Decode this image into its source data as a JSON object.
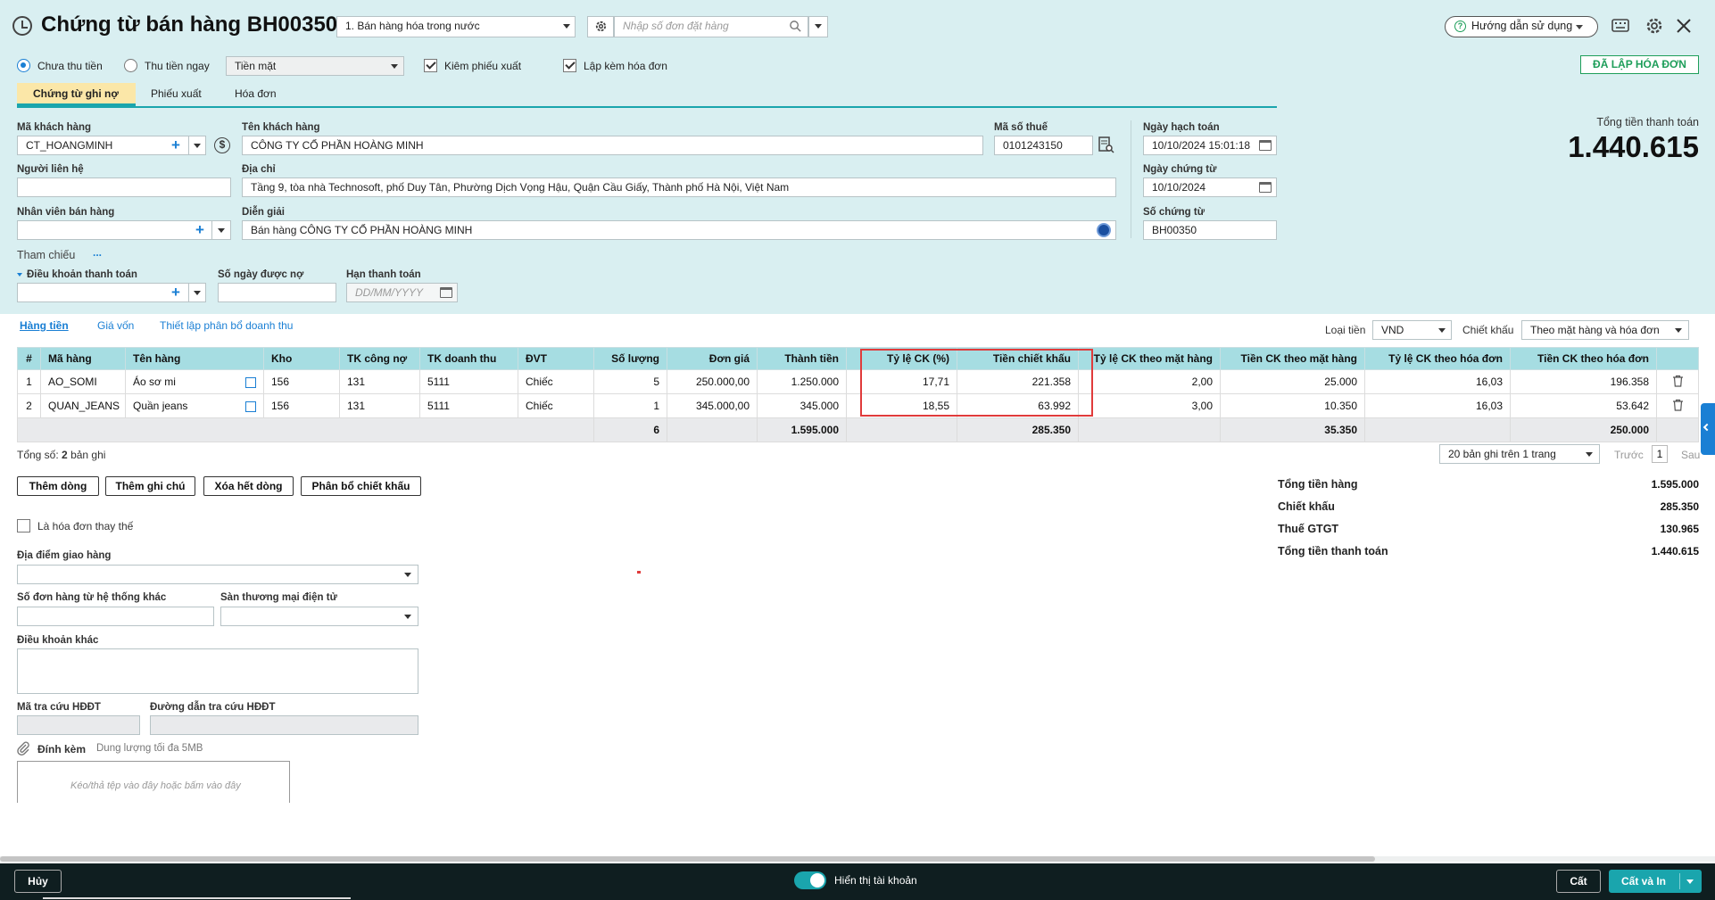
{
  "header": {
    "title": "Chứng từ bán hàng BH00350",
    "sale_type": "1. Bán hàng hóa trong nước",
    "order_search_placeholder": "Nhập số đơn đặt hàng",
    "guide_label": "Hướng dẫn sử dụng",
    "invoice_status": "ĐÃ LẬP HÓA ĐƠN"
  },
  "payment": {
    "unpaid": "Chưa thu tiền",
    "paid_now": "Thu tiền ngay",
    "method": "Tiền mặt",
    "export_note": "Kiêm phiếu xuất",
    "with_invoice": "Lập kèm hóa đơn"
  },
  "tabs": [
    "Chứng từ ghi nợ",
    "Phiếu xuất",
    "Hóa đơn"
  ],
  "form": {
    "customer_code_label": "Mã khách hàng",
    "customer_code": "CT_HOANGMINH",
    "customer_name_label": "Tên khách hàng",
    "customer_name": "CÔNG TY CỔ PHẦN HOÀNG MINH",
    "tax_code_label": "Mã số thuế",
    "tax_code": "0101243150",
    "contact_label": "Người liên hệ",
    "address_label": "Địa chỉ",
    "address": "Tầng 9, tòa nhà Technosoft, phố Duy Tân, Phường Dịch Vọng Hậu, Quận Cầu Giấy, Thành phố Hà Nội, Việt Nam",
    "staff_label": "Nhân viên bán hàng",
    "note_label": "Diễn giải",
    "note": "Bán hàng CÔNG TY CỔ PHẦN HOÀNG MINH",
    "reference_label": "Tham chiếu",
    "reference_more": "...",
    "terms_label": "Điều khoản thanh toán",
    "debt_days_label": "Số ngày được nợ",
    "due_label": "Hạn thanh toán",
    "due_placeholder": "DD/MM/YYYY",
    "posting_date_label": "Ngày hạch toán",
    "posting_date": "10/10/2024 15:01:18",
    "voucher_date_label": "Ngày chứng từ",
    "voucher_date": "10/10/2024",
    "voucher_no_label": "Số chứng từ",
    "voucher_no": "BH00350",
    "total_label": "Tổng tiền thanh toán",
    "total": "1.440.615"
  },
  "subtabs": [
    "Hàng tiền",
    "Giá vốn",
    "Thiết lập phân bổ doanh thu"
  ],
  "currency_label": "Loại tiền",
  "currency": "VND",
  "discount_label": "Chiết khấu",
  "discount_mode": "Theo mặt hàng và hóa đơn",
  "table": {
    "columns": [
      "#",
      "Mã hàng",
      "Tên hàng",
      "Kho",
      "TK công nợ",
      "TK doanh thu",
      "ĐVT",
      "Số lượng",
      "Đơn giá",
      "Thành tiền",
      "Tỷ lệ CK (%)",
      "Tiền chiết khấu",
      "Tỷ lệ CK theo mặt hàng",
      "Tiền CK theo mặt hàng",
      "Tỷ lệ CK theo hóa đơn",
      "Tiền CK theo hóa đơn"
    ],
    "rows": [
      [
        "1",
        "AO_SOMI",
        "Áo sơ mi",
        "156",
        "131",
        "5111",
        "Chiếc",
        "5",
        "250.000,00",
        "1.250.000",
        "17,71",
        "221.358",
        "2,00",
        "25.000",
        "16,03",
        "196.358"
      ],
      [
        "2",
        "QUAN_JEANS",
        "Quần jeans",
        "156",
        "131",
        "5111",
        "Chiếc",
        "1",
        "345.000,00",
        "345.000",
        "18,55",
        "63.992",
        "3,00",
        "10.350",
        "16,03",
        "53.642"
      ]
    ],
    "totals": {
      "qty": "6",
      "amount": "1.595.000",
      "discount": "285.350",
      "item_discount": "35.350",
      "invoice_discount": "250.000"
    }
  },
  "pager": {
    "count_prefix": "Tổng số:",
    "count": "2",
    "count_suffix": "bản ghi",
    "per_page": "20 bản ghi trên 1 trang",
    "prev": "Trước",
    "page": "1",
    "next": "Sau"
  },
  "actions": [
    "Thêm dòng",
    "Thêm ghi chú",
    "Xóa hết dòng",
    "Phân bổ chiết khấu"
  ],
  "summary": [
    {
      "label": "Tổng tiền hàng",
      "value": "1.595.000"
    },
    {
      "label": "Chiết khấu",
      "value": "285.350"
    },
    {
      "label": "Thuế GTGT",
      "value": "130.965"
    },
    {
      "label": "Tổng tiền thanh toán",
      "value": "1.440.615"
    }
  ],
  "extra": {
    "replace_invoice": "Là hóa đơn thay thế",
    "delivery_label": "Địa điểm giao hàng",
    "other_order_label": "Số đơn hàng từ hệ thống khác",
    "ecommerce_label": "Sàn thương mại điện tử",
    "other_terms_label": "Điều khoản khác",
    "lookup_code_label": "Mã tra cứu HĐĐT",
    "lookup_url_label": "Đường dẫn tra cứu HĐĐT",
    "attach_label": "Đính kèm",
    "attach_limit": "Dung lượng tối đa 5MB",
    "drop_hint": "Kéo/thả tệp vào đây hoặc bấm vào đây"
  },
  "footer": {
    "cancel": "Hủy",
    "show_account": "Hiển thị tài khoản",
    "save": "Cất",
    "save_print": "Cất và In"
  }
}
